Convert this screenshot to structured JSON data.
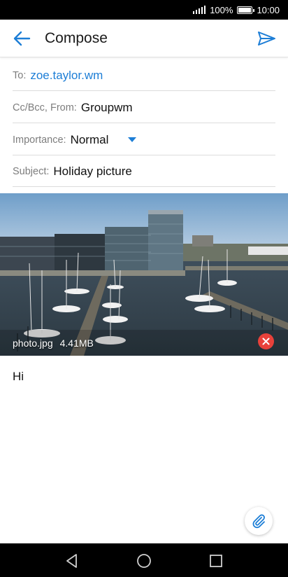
{
  "status_bar": {
    "battery": "100%",
    "time": "10:00"
  },
  "app_bar": {
    "title": "Compose",
    "back_icon": "arrow-left-icon",
    "send_icon": "send-icon"
  },
  "fields": {
    "to": {
      "label": "To:",
      "value": "zoe.taylor.wm"
    },
    "from": {
      "label": "Cc/Bcc, From:",
      "value": "Groupwm"
    },
    "importance": {
      "label": "Importance:",
      "value": "Normal"
    },
    "subject": {
      "label": "Subject:",
      "value": "Holiday picture"
    }
  },
  "attachment": {
    "filename": "photo.jpg",
    "size": "4.41MB",
    "remove_icon": "close-icon"
  },
  "body": {
    "text": "Hi"
  },
  "fab": {
    "icon": "paperclip-icon"
  },
  "nav_bar": {
    "back_icon": "nav-back-icon",
    "home_icon": "nav-home-icon",
    "recents_icon": "nav-recents-icon"
  },
  "colors": {
    "accent": "#1d7ed6",
    "remove": "#e8413a"
  }
}
